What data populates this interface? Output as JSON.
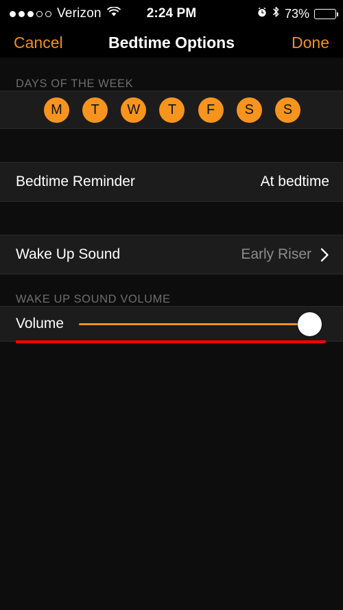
{
  "status_bar": {
    "signal_dots_filled": 3,
    "signal_dots_total": 5,
    "carrier": "Verizon",
    "wifi_icon": "wifi-icon",
    "time": "2:24 PM",
    "alarm_icon": "alarm-clock-icon",
    "bluetooth_icon": "bluetooth-icon",
    "battery_percent": "73%",
    "battery_level": 73,
    "battery_color": "#ffd400"
  },
  "nav_bar": {
    "cancel_label": "Cancel",
    "title": "Bedtime Options",
    "done_label": "Done",
    "accent_color": "#f19021"
  },
  "sections": {
    "days": {
      "header": "DAYS OF THE WEEK",
      "days": [
        {
          "label": "M",
          "name": "monday",
          "selected": true
        },
        {
          "label": "T",
          "name": "tuesday",
          "selected": true
        },
        {
          "label": "W",
          "name": "wednesday",
          "selected": true
        },
        {
          "label": "T",
          "name": "thursday",
          "selected": true
        },
        {
          "label": "F",
          "name": "friday",
          "selected": true
        },
        {
          "label": "S",
          "name": "saturday",
          "selected": true
        },
        {
          "label": "S",
          "name": "sunday",
          "selected": true
        }
      ],
      "selected_color": "#f7941d"
    },
    "bedtime_reminder": {
      "title": "Bedtime Reminder",
      "value": "At bedtime"
    },
    "wake_up_sound": {
      "title": "Wake Up Sound",
      "value": "Early Riser",
      "chevron_icon": "chevron-right-icon"
    },
    "volume": {
      "header": "WAKE UP SOUND VOLUME",
      "label": "Volume",
      "level_percent": 100,
      "track_color": "#ee9020",
      "thumb_color": "#ffffff",
      "highlight_color": "#ff0000"
    }
  }
}
